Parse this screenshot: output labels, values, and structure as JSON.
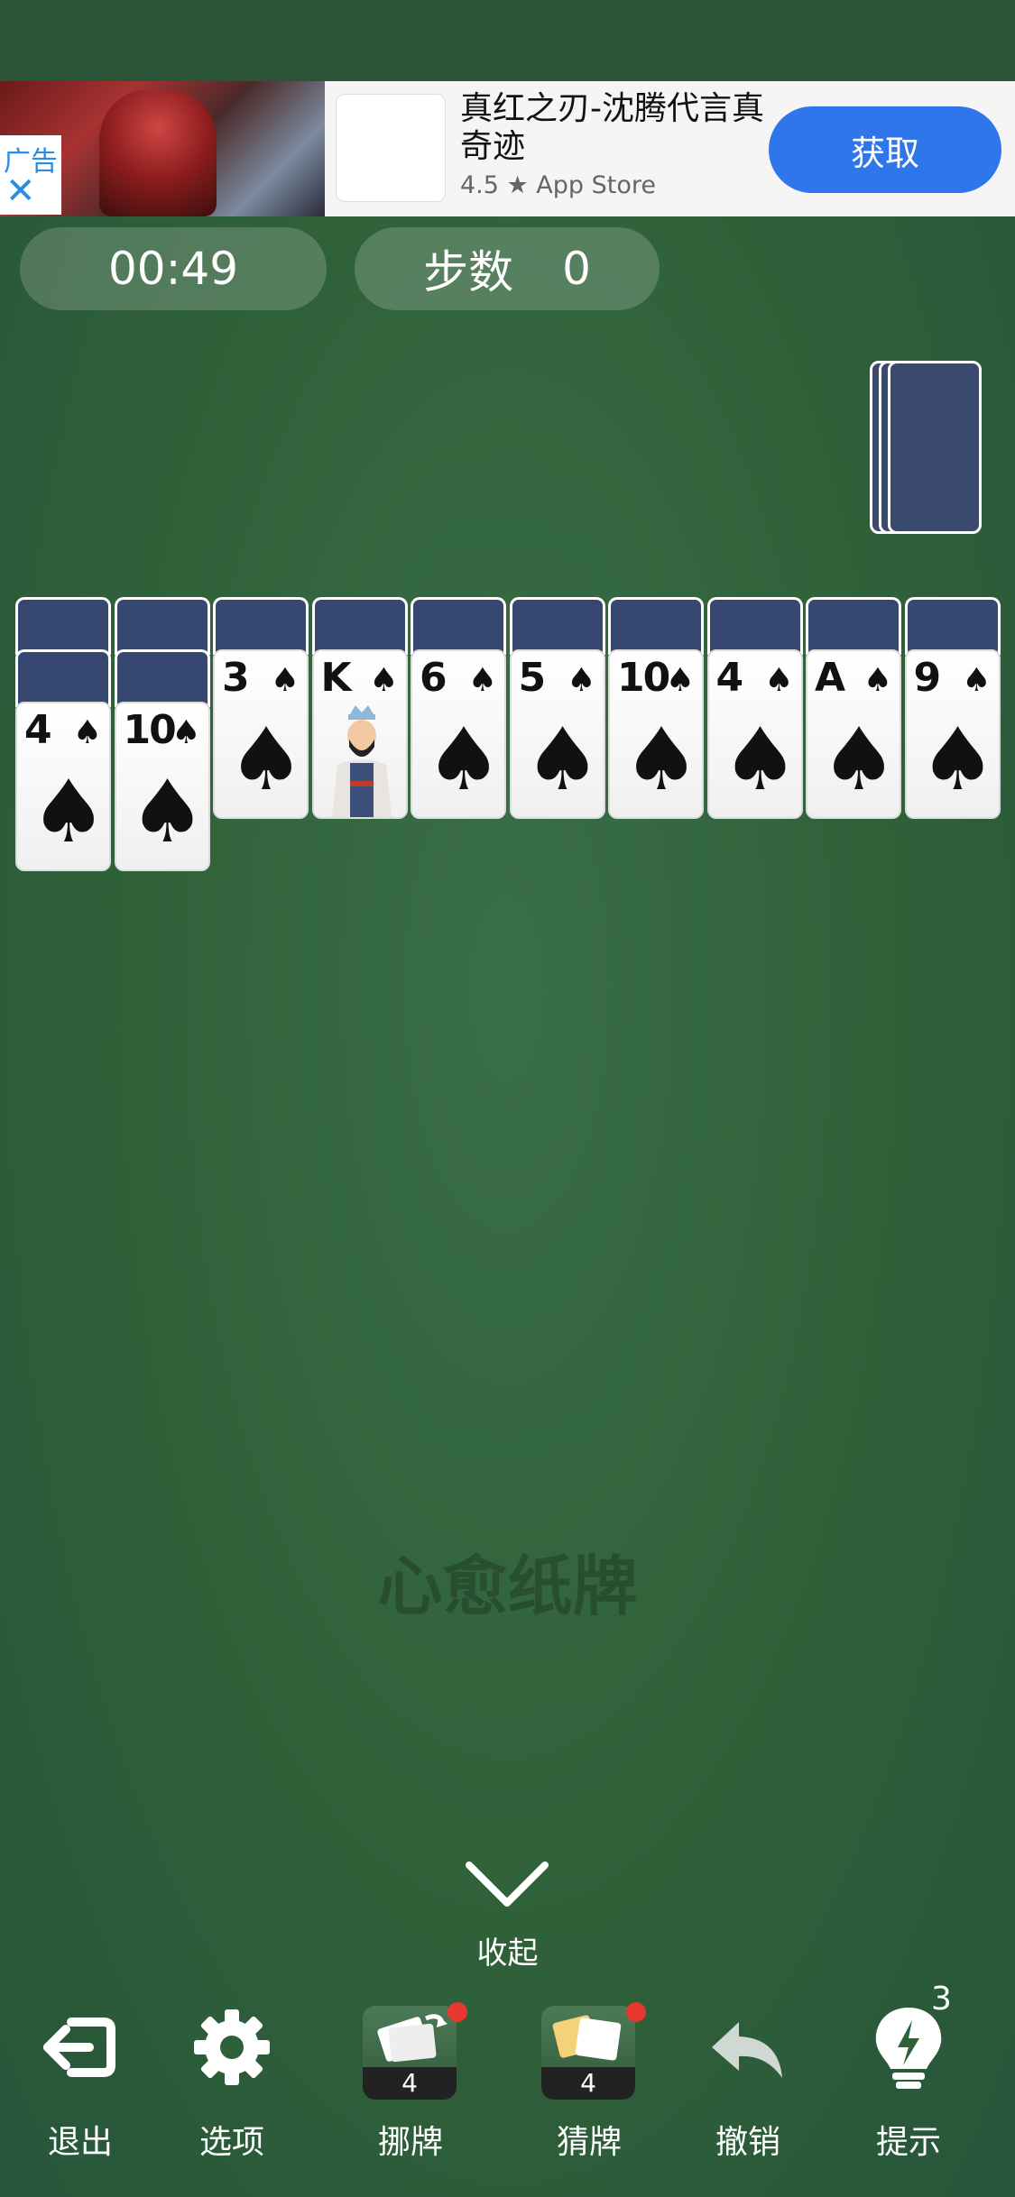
{
  "ad": {
    "tag": "广告",
    "close": "✕",
    "title": "真红之刃-沈腾代言真奇迹",
    "rating": "4.5 ★ App Store",
    "button": "获取"
  },
  "timer": "00:49",
  "moves": {
    "label": "步数",
    "value": "0"
  },
  "stock": {
    "piles": 3
  },
  "tableau": [
    {
      "facedown": 2,
      "rank": "4",
      "suit": "♠"
    },
    {
      "facedown": 2,
      "rank": "10",
      "suit": "♠"
    },
    {
      "facedown": 1,
      "rank": "3",
      "suit": "♠"
    },
    {
      "facedown": 1,
      "rank": "K",
      "suit": "♠"
    },
    {
      "facedown": 1,
      "rank": "6",
      "suit": "♠"
    },
    {
      "facedown": 1,
      "rank": "5",
      "suit": "♠"
    },
    {
      "facedown": 1,
      "rank": "10",
      "suit": "♠"
    },
    {
      "facedown": 1,
      "rank": "4",
      "suit": "♠"
    },
    {
      "facedown": 1,
      "rank": "A",
      "suit": "♠"
    },
    {
      "facedown": 1,
      "rank": "9",
      "suit": "♠"
    }
  ],
  "watermark": "心愈纸牌",
  "collapse_label": "收起",
  "toolbar": {
    "exit": "退出",
    "options": "选项",
    "move_cards": "挪牌",
    "move_cards_count": "4",
    "guess_cards": "猜牌",
    "guess_cards_count": "4",
    "undo": "撤销",
    "hint": "提示",
    "hint_count": "3"
  },
  "colors": {
    "felt": "#2f6139",
    "card_back": "#364870",
    "ad_button": "#2f76ea",
    "badge": "#e8372f"
  }
}
